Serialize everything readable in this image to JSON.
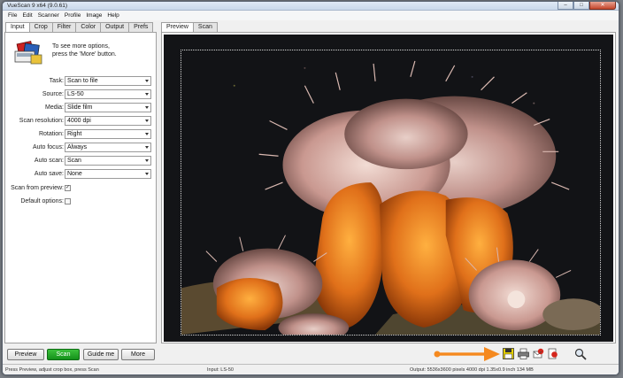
{
  "window": {
    "title": "VueScan 9 x64 (9.0.61)",
    "minimize": "–",
    "maximize": "□",
    "close": "✕"
  },
  "menu": [
    "File",
    "Edit",
    "Scanner",
    "Profile",
    "Image",
    "Help"
  ],
  "left_tabs": [
    "Input",
    "Crop",
    "Filter",
    "Color",
    "Output",
    "Prefs"
  ],
  "right_tabs": [
    "Preview",
    "Scan"
  ],
  "hint": {
    "line1": "To see more options,",
    "line2": "press the 'More' button."
  },
  "fields": {
    "task": {
      "label": "Task:",
      "value": "Scan to file"
    },
    "source": {
      "label": "Source:",
      "value": "LS-50"
    },
    "media": {
      "label": "Media:",
      "value": "Slide film"
    },
    "resolution": {
      "label": "Scan resolution:",
      "value": "4000 dpi"
    },
    "rotation": {
      "label": "Rotation:",
      "value": "Right"
    },
    "autofocus": {
      "label": "Auto focus:",
      "value": "Always"
    },
    "autoscan": {
      "label": "Auto scan:",
      "value": "Scan"
    },
    "autosave": {
      "label": "Auto save:",
      "value": "None"
    }
  },
  "checks": {
    "scan_from_preview": {
      "label": "Scan from preview:",
      "checked": true,
      "mark": "✓"
    },
    "default_options": {
      "label": "Default options:",
      "checked": false,
      "mark": ""
    }
  },
  "buttons": {
    "preview": "Preview",
    "scan": "Scan",
    "guide": "Guide me",
    "more": "More"
  },
  "toolbar_icons": [
    "save-icon",
    "print-icon",
    "scan-to-email-icon",
    "scan-to-pdf-icon",
    "zoom-icon"
  ],
  "colors": {
    "scan_button": "#1a9a20",
    "arrow": "#f5891f",
    "save_icon": "#e8d200"
  },
  "status": {
    "left": "Press Preview, adjust crop box, press Scan",
    "middle": "Input: LS-50",
    "right": "Output: 5536x3600 pixels 4000 dpi 1.35x0.9 inch 134 MB"
  }
}
